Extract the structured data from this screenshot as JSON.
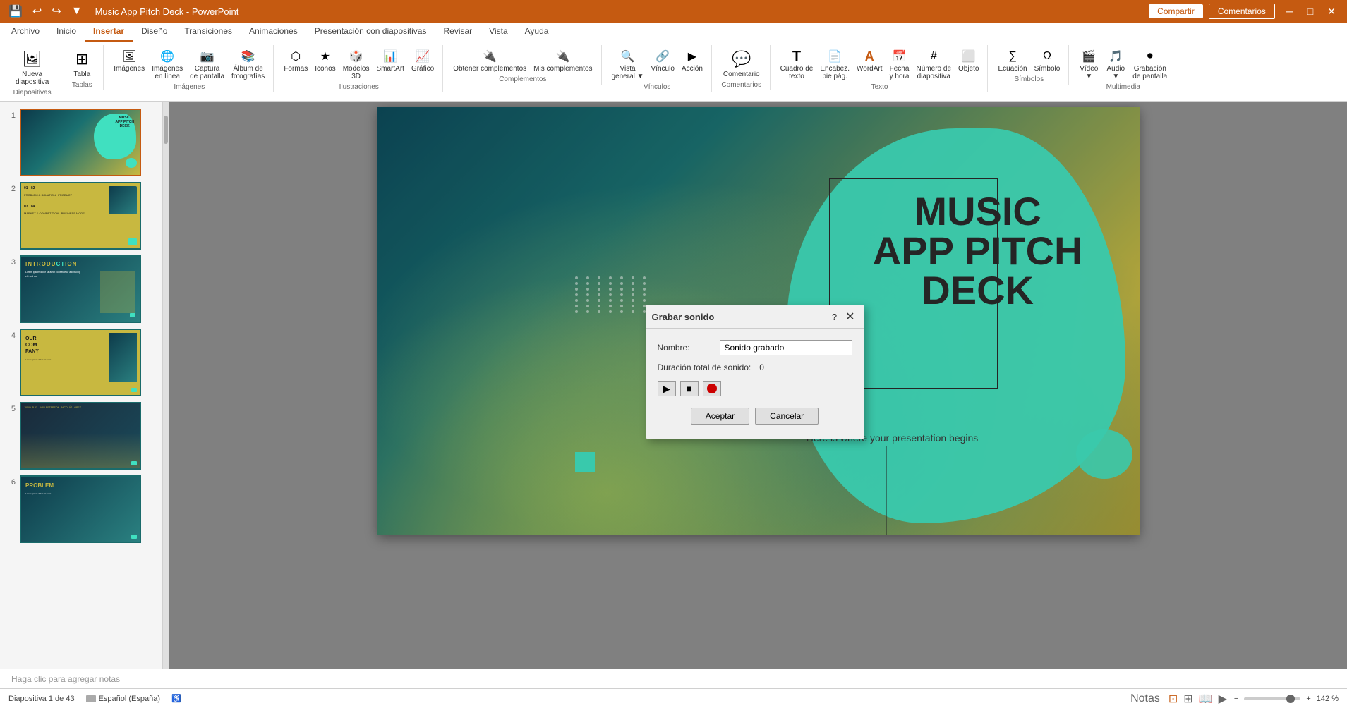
{
  "app": {
    "title": "Music App Pitch Deck - PowerPoint",
    "tabs": [
      "Archivo",
      "Inicio",
      "Insertar",
      "Diseño",
      "Transiciones",
      "Animaciones",
      "Presentación con diapositivas",
      "Revisar",
      "Vista",
      "Ayuda"
    ],
    "active_tab": "Insertar"
  },
  "top_bar": {
    "share_label": "Compartir",
    "comments_label": "Comentarios"
  },
  "ribbon": {
    "groups": [
      {
        "name": "Diapositivas",
        "items": [
          {
            "label": "Nueva\ndiapositiva",
            "icon": "🖼"
          },
          {
            "label": "Tabla",
            "icon": "⊞"
          }
        ]
      },
      {
        "name": "Imágenes",
        "items": [
          {
            "label": "Imágenes",
            "icon": "🖼"
          },
          {
            "label": "Imágenes\nen línea",
            "icon": "🌐"
          },
          {
            "label": "Captura\nde pantalla",
            "icon": "📷"
          },
          {
            "label": "Álbum de\nfotografías",
            "icon": "📚"
          }
        ]
      },
      {
        "name": "Ilustraciones",
        "items": [
          {
            "label": "Formas",
            "icon": "◯"
          },
          {
            "label": "Iconos",
            "icon": "★"
          },
          {
            "label": "Modelos\n3D",
            "icon": "🎲"
          },
          {
            "label": "SmartArt",
            "icon": "📊"
          },
          {
            "label": "Gráfico",
            "icon": "📈"
          }
        ]
      },
      {
        "name": "Complementos",
        "items": [
          {
            "label": "Obtener complementos",
            "icon": "🔌"
          },
          {
            "label": "Mis complementos",
            "icon": "🔌"
          }
        ]
      },
      {
        "name": "Vínculos",
        "items": [
          {
            "label": "Vista\ngeneral",
            "icon": "🔍"
          },
          {
            "label": "Vínculo",
            "icon": "🔗"
          },
          {
            "label": "Acción",
            "icon": "▶"
          }
        ]
      },
      {
        "name": "Comentarios",
        "items": [
          {
            "label": "Comentario",
            "icon": "💬"
          }
        ]
      },
      {
        "name": "Texto",
        "items": [
          {
            "label": "Cuadro de\ntexto",
            "icon": "T"
          },
          {
            "label": "Encabez.\npie pág.",
            "icon": "📄"
          },
          {
            "label": "WordArt",
            "icon": "A"
          },
          {
            "label": "Fecha\ny hora",
            "icon": "📅"
          },
          {
            "label": "Número de\ndiapositiva",
            "icon": "#"
          },
          {
            "label": "Objeto",
            "icon": "⬜"
          }
        ]
      },
      {
        "name": "Símbolos",
        "items": [
          {
            "label": "Ecuación",
            "icon": "∑"
          },
          {
            "label": "Símbolo",
            "icon": "Ω"
          }
        ]
      },
      {
        "name": "Multimedia",
        "items": [
          {
            "label": "Vídeo",
            "icon": "🎬"
          },
          {
            "label": "Audio",
            "icon": "🎵"
          },
          {
            "label": "Grabación\nde pantalla",
            "icon": "⏺"
          }
        ]
      }
    ]
  },
  "slide_panel": {
    "slides": [
      {
        "num": 1,
        "active": true,
        "type": "title"
      },
      {
        "num": 2,
        "active": false,
        "type": "toc"
      },
      {
        "num": 3,
        "active": false,
        "type": "intro"
      },
      {
        "num": 4,
        "active": false,
        "type": "company"
      },
      {
        "num": 5,
        "active": false,
        "type": "team"
      },
      {
        "num": 6,
        "active": false,
        "type": "problem"
      }
    ]
  },
  "slide": {
    "title_line1": "MUSIC",
    "title_line2": "APP PITCH",
    "title_line3": "DECK",
    "subtitle": "Here is where your presentation begins"
  },
  "dialog": {
    "title": "Grabar sonido",
    "nombre_label": "Nombre:",
    "nombre_value": "Sonido grabado",
    "duracion_label": "Duración total de sonido:",
    "duracion_value": "0",
    "accept_label": "Aceptar",
    "cancel_label": "Cancelar"
  },
  "status_bar": {
    "slide_info": "Diapositiva 1 de 43",
    "language": "Español (España)",
    "notes_label": "Notas",
    "zoom": "142 %",
    "notes_placeholder": "Haga clic para agregar notas"
  }
}
